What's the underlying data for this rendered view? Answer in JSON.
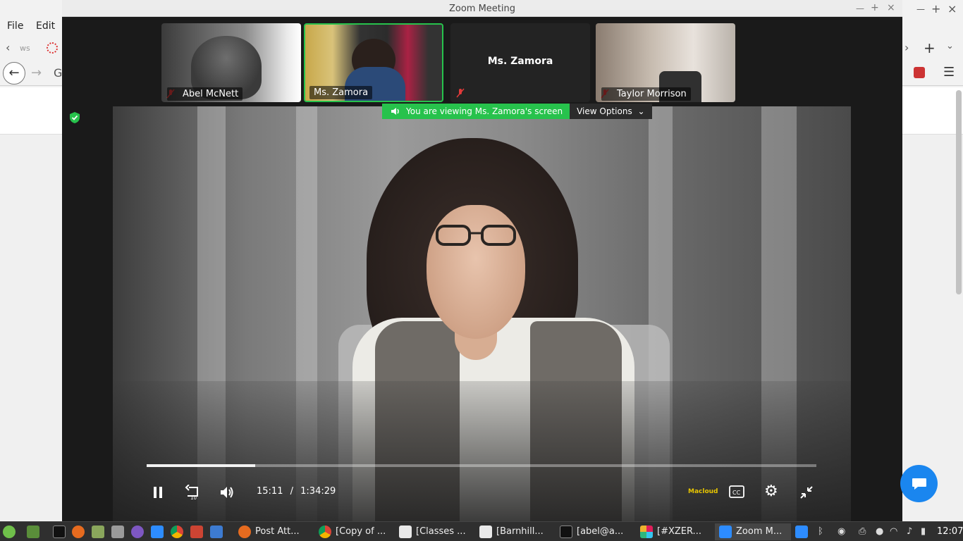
{
  "browser": {
    "menu": [
      "File",
      "Edit"
    ],
    "tab_fragment": "ws"
  },
  "zoom": {
    "window_title": "Zoom Meeting",
    "participants": [
      {
        "name": "Abel McNett",
        "muted": true
      },
      {
        "name": "Ms. Zamora",
        "muted": false,
        "active_speaker": true
      },
      {
        "name": "Ms. Zamora",
        "muted": true,
        "video_off": true
      },
      {
        "name": "Taylor Morrison",
        "muted": true
      }
    ],
    "share_banner": "You are viewing Ms. Zamora's screen",
    "view_options_label": "View Options",
    "accent_color": "#27c24c"
  },
  "video_player": {
    "current_time": "15:11",
    "separator": "/",
    "duration": "1:34:29",
    "progress_fraction": 0.162,
    "logo_text": "Macloud"
  },
  "taskbar": {
    "tasks": [
      {
        "label": "Post Att...",
        "icon": "firefox-icon"
      },
      {
        "label": "[Copy of ...",
        "icon": "chrome-icon"
      },
      {
        "label": "[Classes ...",
        "icon": "chart-app-icon"
      },
      {
        "label": "[Barnhill...",
        "icon": "chart-app-icon"
      },
      {
        "label": "[abel@a...",
        "icon": "terminal-icon"
      },
      {
        "label": "[#XZER...",
        "icon": "slack-icon"
      },
      {
        "label": "Zoom M...",
        "icon": "zoom-icon",
        "active": true
      }
    ],
    "clock": "12:07"
  }
}
